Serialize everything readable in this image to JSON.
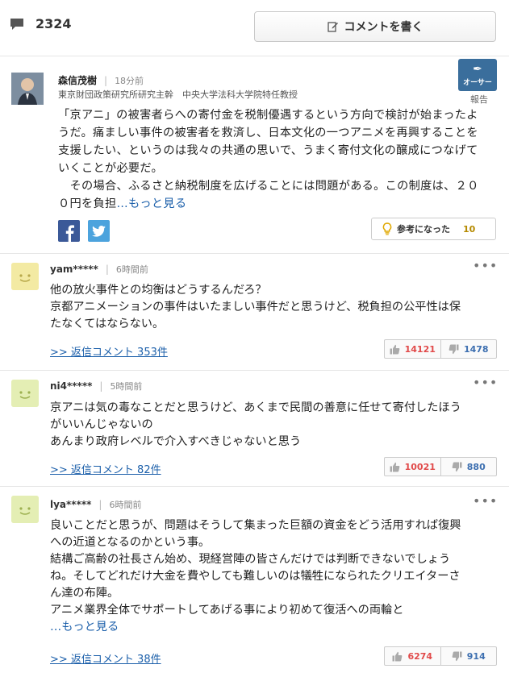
{
  "header": {
    "comment_count": "2324",
    "write_button_label": "コメントを書く"
  },
  "author": {
    "name": "森信茂樹",
    "time": "18分前",
    "title": "東京財団政策研究所研究主幹　中央大学法科大学院特任教授",
    "badge_label": "オーサー",
    "report_label": "報告",
    "text_lines": [
      "「京アニ」の被害者らへの寄付金を税制優遇するという方向で検討が始まったよ",
      "うだ。痛ましい事件の被害者を救済し、日本文化の一つアニメを再興することを",
      "支援したい、というのは我々の共通の思いで、うまく寄付文化の醸成につなげて",
      "いくことが必要だ。",
      "　その場合、ふるさと納税制度を広げることには問題がある。この制度は、２０",
      "０円を負担"
    ],
    "more_label": "…もっと見る",
    "helpful_label": "参考になった",
    "helpful_count": "10"
  },
  "comments": [
    {
      "user": "yam*****",
      "time": "6時間前",
      "lines": [
        "他の放火事件との均衡はどうするんだろ？",
        "京都アニメーションの事件はいたましい事件だと思うけど、税負担の公平性は保",
        "たなくてはならない。"
      ],
      "more": "",
      "reply_label": ">> 返信コメント 353件",
      "likes": "14121",
      "dislikes": "1478"
    },
    {
      "user": "ni4*****",
      "time": "5時間前",
      "lines": [
        "京アニは気の毒なことだと思うけど、あくまで民間の善意に任せて寄付したほう",
        "がいいんじゃないの",
        "あんまり政府レベルで介入すべきじゃないと思う"
      ],
      "more": "",
      "reply_label": ">> 返信コメント 82件",
      "likes": "10021",
      "dislikes": "880"
    },
    {
      "user": "lya*****",
      "time": "6時間前",
      "lines": [
        "良いことだと思うが、問題はそうして集まった巨額の資金をどう活用すれば復興",
        "への近道となるのかという事。",
        "結構ご高齢の社長さん始め、現経営陣の皆さんだけでは判断できないでしょう",
        "ね。そしてどれだけ大金を費やしても難しいのは犠牲になられたクリエイターさ",
        "ん達の布陣。",
        "アニメ業界全体でサポートしてあげる事により初めて復活への両輪と"
      ],
      "more": "…もっと見る",
      "reply_label": ">> 返信コメント 38件",
      "likes": "6274",
      "dislikes": "914"
    }
  ],
  "colors": {
    "link": "#1b5faa",
    "like": "#e14a4a",
    "dislike": "#3d6fb0",
    "facebook": "#3b5998",
    "twitter": "#4ca3dd",
    "author_badge": "#3a6e9c"
  },
  "icons": {
    "count": "speech-bubble-icon",
    "write": "pencil-icon",
    "helpful": "lightbulb-icon",
    "like": "thumbs-up-icon",
    "dislike": "thumbs-down-icon",
    "menu": "more-dots-icon"
  }
}
